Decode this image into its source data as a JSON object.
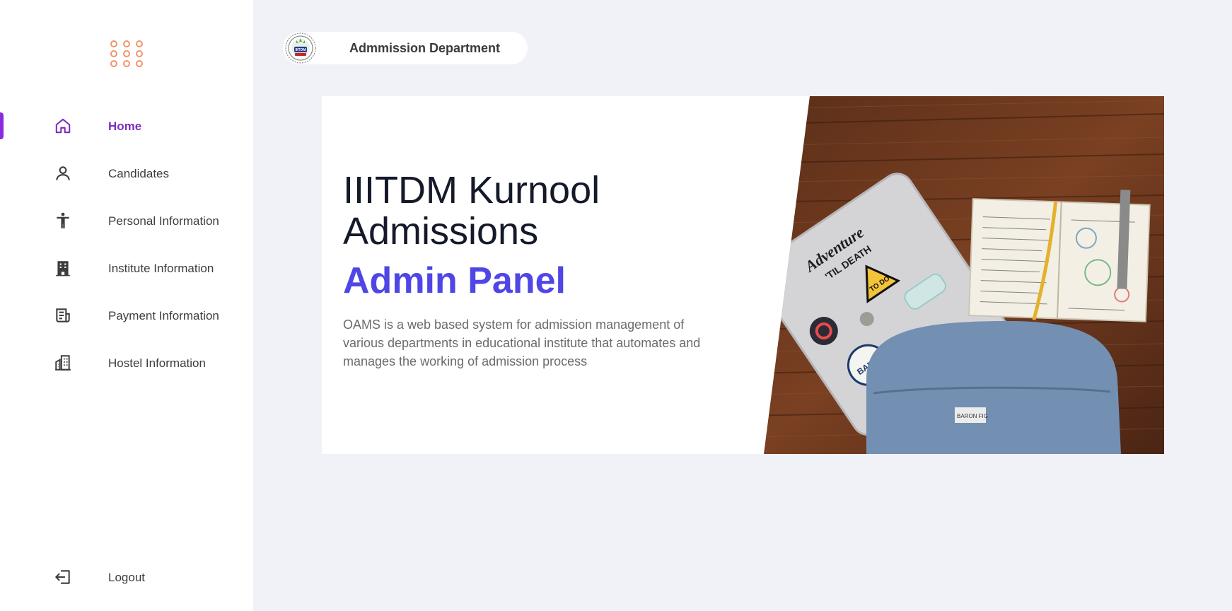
{
  "sidebar": {
    "menu_icon": "apps-grid-icon",
    "items": [
      {
        "label": "Home",
        "icon": "home-icon",
        "active": true
      },
      {
        "label": "Candidates",
        "icon": "user-icon",
        "active": false
      },
      {
        "label": "Personal Information",
        "icon": "accessibility-icon",
        "active": false
      },
      {
        "label": "Institute Information",
        "icon": "building-icon",
        "active": false
      },
      {
        "label": "Payment Information",
        "icon": "receipt-icon",
        "active": false
      },
      {
        "label": "Hostel Information",
        "icon": "hostel-icon",
        "active": false
      }
    ],
    "logout": {
      "label": "Logout",
      "icon": "logout-icon"
    }
  },
  "header": {
    "department": "Admmission Department",
    "logo": "institute-seal",
    "logo_text": "IIITDM"
  },
  "hero": {
    "title": "IIITDM Kurnool Admissions",
    "subtitle": "Admin Panel",
    "description": "OAMS is a web based system for admission management of various departments in educational institute that automates and manages the working of admission process",
    "photo": {
      "description": "desk-photo",
      "sticker_adventure": "Adventure",
      "sticker_adventure_2": "'TIL DEATH",
      "sticker_todo": "TO DO",
      "sticker_banff": "BANFF",
      "backpack_tag": "BARON FIG"
    }
  },
  "colors": {
    "accent": "#7b2cbf",
    "indigo": "#4f46e5",
    "orange": "#f0956b",
    "background": "#f1f2f7"
  }
}
